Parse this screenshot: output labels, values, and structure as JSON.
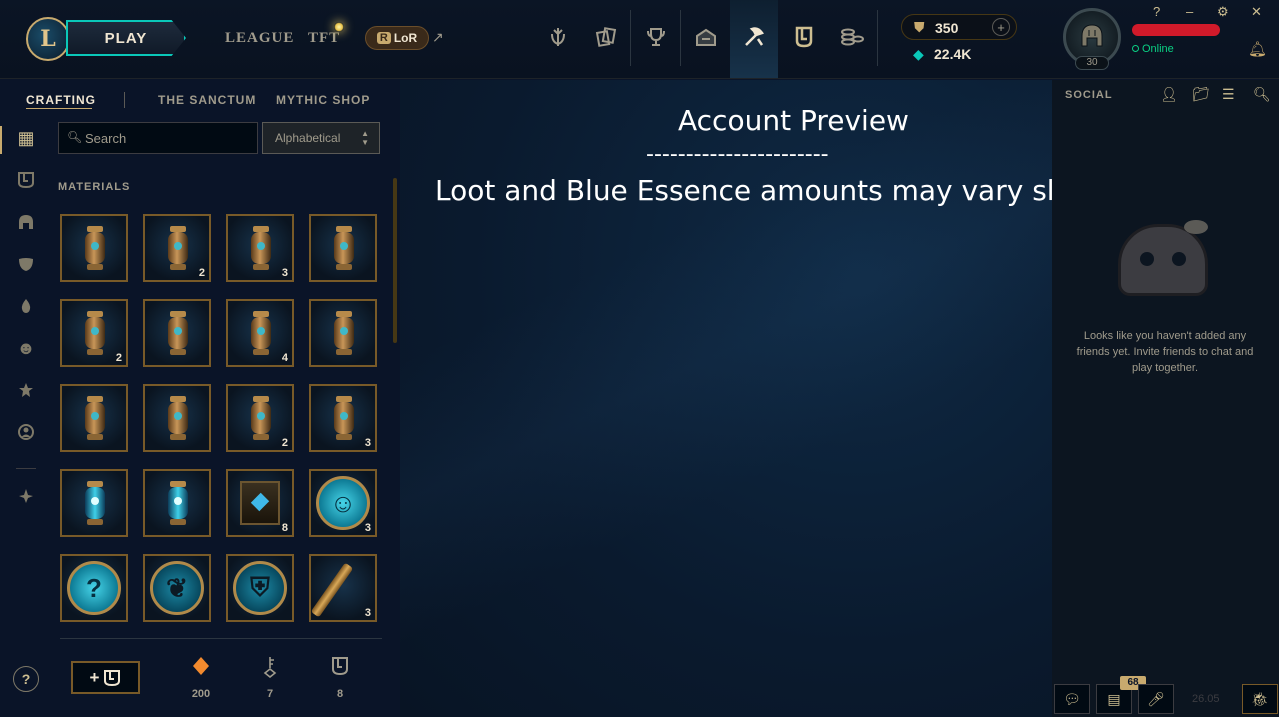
{
  "header": {
    "logo_letter": "L",
    "play_label": "PLAY",
    "nav_links": [
      "LEAGUE",
      "TFT"
    ],
    "lor": {
      "badge": "R",
      "label": "LoR",
      "external_icon": "external-link-icon"
    },
    "nav_icons": [
      "home-icon",
      "collection-icon",
      "profile-trophy-icon",
      "clash-icon",
      "loot-icon",
      "collection-sanctum-icon",
      "store-icon"
    ],
    "active_nav": "loot-icon",
    "rp": {
      "value": "350",
      "add": "+"
    },
    "be": {
      "value": "22.4K"
    },
    "profile": {
      "level": "30",
      "status": "Online"
    },
    "window_controls": {
      "help": "?",
      "minimize": "–",
      "settings": "⚙",
      "close": "✕"
    }
  },
  "subnav": {
    "tabs": [
      "CRAFTING",
      "THE SANCTUM",
      "MYTHIC SHOP"
    ],
    "active": "CRAFTING"
  },
  "loot": {
    "search_placeholder": "Search",
    "sort_value": "Alphabetical",
    "section_title": "MATERIALS",
    "items": [
      {
        "kind": "shard",
        "count": ""
      },
      {
        "kind": "shard",
        "count": "2"
      },
      {
        "kind": "shard",
        "count": "3"
      },
      {
        "kind": "shard",
        "count": ""
      },
      {
        "kind": "shard",
        "count": "2"
      },
      {
        "kind": "shard",
        "count": ""
      },
      {
        "kind": "shard",
        "count": "4"
      },
      {
        "kind": "shard",
        "count": ""
      },
      {
        "kind": "shard",
        "count": ""
      },
      {
        "kind": "shard",
        "count": ""
      },
      {
        "kind": "shard",
        "count": "2"
      },
      {
        "kind": "shard",
        "count": "3"
      },
      {
        "kind": "shard-blue",
        "count": ""
      },
      {
        "kind": "shard-blue",
        "count": ""
      },
      {
        "kind": "chest",
        "count": "8"
      },
      {
        "kind": "orb-emote",
        "count": "3"
      },
      {
        "kind": "orb-mystery",
        "count": ""
      },
      {
        "kind": "orb-ward",
        "count": ""
      },
      {
        "kind": "orb-champion",
        "count": ""
      },
      {
        "kind": "key",
        "count": "3"
      }
    ],
    "footer": {
      "craft_label": "+",
      "stats": [
        {
          "icon": "orange-essence-icon",
          "value": "200",
          "color": "#f28a2e"
        },
        {
          "icon": "key-fragment-icon",
          "value": "7",
          "color": "#a09b8c"
        },
        {
          "icon": "mythic-chest-icon",
          "value": "8",
          "color": "#a09b8c"
        }
      ]
    }
  },
  "overlay": {
    "title": "Account Preview",
    "divider": "-----------------------",
    "subtitle": "Loot and Blue Essence amounts may vary slightly"
  },
  "social": {
    "title": "SOCIAL",
    "empty_message": "Looks like you haven't added any friends yet. Invite friends to chat and play together.",
    "notification_count": "68",
    "version": "26.05"
  },
  "colors": {
    "gold": "#c8aa6e",
    "teal": "#0ac8b9",
    "online_green": "#0acf83",
    "background": "#0a1428"
  }
}
